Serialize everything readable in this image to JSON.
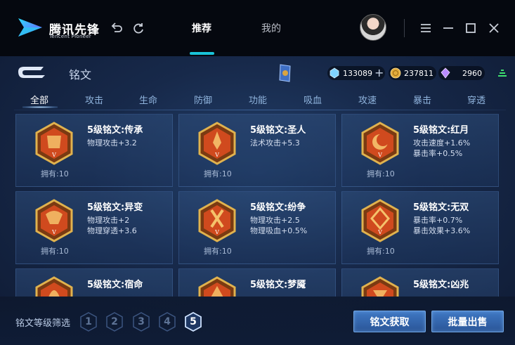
{
  "titlebar": {
    "brand": "腾讯先锋",
    "brand_sub": "Tencent Pioneer",
    "tabs": [
      {
        "label": "推荐",
        "active": true
      },
      {
        "label": "我的",
        "active": false
      }
    ],
    "icons": [
      "back-arrow-icon",
      "refresh-icon",
      "menu-icon",
      "minimize-icon",
      "maximize-icon",
      "close-icon"
    ]
  },
  "header": {
    "title": "铭文",
    "currencies": [
      {
        "name": "diamond",
        "value": "133089",
        "has_plus": true
      },
      {
        "name": "gold-coin",
        "value": "237811",
        "has_plus": false
      },
      {
        "name": "crystal",
        "value": "2960",
        "has_plus": false
      }
    ]
  },
  "tabs": [
    "全部",
    "攻击",
    "生命",
    "防御",
    "功能",
    "吸血",
    "攻速",
    "暴击",
    "穿透"
  ],
  "active_tab": "全部",
  "cards": [
    {
      "name": "5级铭文:传承",
      "stats": [
        "物理攻击+3.2"
      ],
      "owned": "拥有:10",
      "level": "V"
    },
    {
      "name": "5级铭文:圣人",
      "stats": [
        "法术攻击+5.3"
      ],
      "owned": "拥有:10",
      "level": "V"
    },
    {
      "name": "5级铭文:红月",
      "stats": [
        "攻击速度+1.6%",
        "暴击率+0.5%"
      ],
      "owned": "拥有:10",
      "level": "V"
    },
    {
      "name": "5级铭文:异变",
      "stats": [
        "物理攻击+2",
        "物理穿透+3.6"
      ],
      "owned": "拥有:10",
      "level": "V"
    },
    {
      "name": "5级铭文:纷争",
      "stats": [
        "物理攻击+2.5",
        "物理吸血+0.5%"
      ],
      "owned": "拥有:10",
      "level": "V"
    },
    {
      "name": "5级铭文:无双",
      "stats": [
        "暴击率+0.7%",
        "暴击效果+3.6%"
      ],
      "owned": "拥有:10",
      "level": "V"
    },
    {
      "name": "5级铭文:宿命",
      "stats": [],
      "owned": "",
      "level": "V"
    },
    {
      "name": "5级铭文:梦魇",
      "stats": [],
      "owned": "",
      "level": "V"
    },
    {
      "name": "5级铭文:凶兆",
      "stats": [],
      "owned": "",
      "level": "V"
    }
  ],
  "footer": {
    "filter_label": "铭文等级筛选",
    "levels": [
      "1",
      "2",
      "3",
      "4",
      "5"
    ],
    "active_level": "5",
    "get_button": "铭文获取",
    "sell_button": "批量出售"
  },
  "colors": {
    "accent": "#19c3d8",
    "card_bg": "#2b4a78",
    "emblem_gold": "#d9a441",
    "emblem_red": "#d04a1e",
    "button_blue": "#3466b0"
  }
}
